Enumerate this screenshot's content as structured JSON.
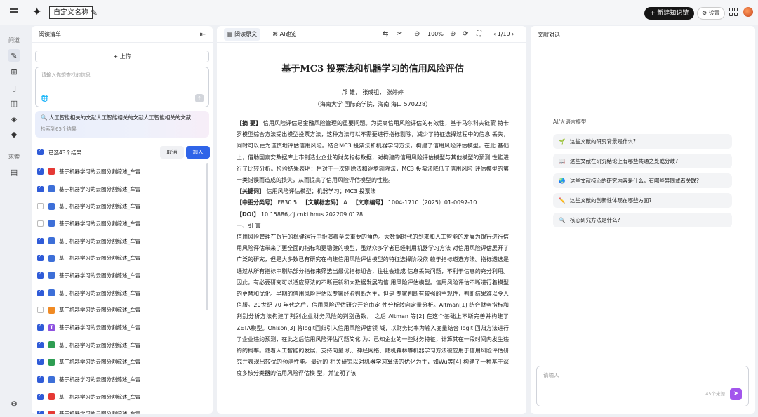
{
  "topbar": {
    "doc_name": "自定义名称",
    "new_kb_label": "+ 新建知识链",
    "settings_label": "⚙ 设置"
  },
  "rail": {
    "section1": "问道",
    "section2": "求索"
  },
  "left": {
    "title": "阅读清单",
    "upload_label": "上传",
    "search_placeholder": "请输入你想查找的信息",
    "query_text": "人工智能相关的文献人工智能相关的文献人工智能相关的文献",
    "query_result": "检索到65个结果",
    "selected_text": "已选43个结果",
    "cancel_label": "取消",
    "join_label": "加入",
    "files": [
      {
        "name": "基于机器学习的云图分割综述_车雷",
        "checked": true,
        "type": "pdf",
        "color": "#e53935",
        "glyph": ""
      },
      {
        "name": "基于机器学习的云图分割综述_车雷",
        "checked": true,
        "type": "web",
        "color": "#3d6fd8",
        "glyph": ""
      },
      {
        "name": "基于机器学习的云图分割综述_车雷",
        "checked": false,
        "type": "web",
        "color": "#3d6fd8",
        "glyph": ""
      },
      {
        "name": "基于机器学习的云图分割综述_车雷",
        "checked": false,
        "type": "web",
        "color": "#3d6fd8",
        "glyph": ""
      },
      {
        "name": "基于机器学习的云图分割综述_车雷",
        "checked": true,
        "type": "web",
        "color": "#3d6fd8",
        "glyph": ""
      },
      {
        "name": "基于机器学习的云图分割综述_车雷",
        "checked": true,
        "type": "web",
        "color": "#3d6fd8",
        "glyph": ""
      },
      {
        "name": "基于机器学习的云图分割综述_车雷",
        "checked": true,
        "type": "web",
        "color": "#3d6fd8",
        "glyph": ""
      },
      {
        "name": "基于机器学习的云图分割综述_车雷",
        "checked": true,
        "type": "web",
        "color": "#3d6fd8",
        "glyph": ""
      },
      {
        "name": "基于机器学习的云图分割综述_车雷",
        "checked": false,
        "type": "ppt",
        "color": "#f08a24",
        "glyph": ""
      },
      {
        "name": "基于机器学习的云图分割综述_车雷",
        "checked": true,
        "type": "text",
        "color": "#8e52e0",
        "glyph": "T"
      },
      {
        "name": "基于机器学习的云图分割综述_车雷",
        "checked": true,
        "type": "sheet",
        "color": "#2e9d52",
        "glyph": ""
      },
      {
        "name": "基于机器学习的云图分割综述_车雷",
        "checked": true,
        "type": "sheet",
        "color": "#2e9d52",
        "glyph": ""
      },
      {
        "name": "基于机器学习的云图分割综述_车雷",
        "checked": true,
        "type": "web",
        "color": "#3d6fd8",
        "glyph": ""
      },
      {
        "name": "基于机器学习的云图分割综述_车雷",
        "checked": true,
        "type": "pdf",
        "color": "#e53935",
        "glyph": ""
      },
      {
        "name": "基于机器学习的云图分割综述_车雷",
        "checked": true,
        "type": "pdf",
        "color": "#e53935",
        "glyph": ""
      }
    ]
  },
  "middle": {
    "tab_read": "阅读原文",
    "tab_ai": "AI速览",
    "zoom": "100%",
    "pager": "1/19",
    "doc_title": "基于MC3 投票法和机器学习的信用风险评估",
    "authors": "邝 雄， 张成祖， 张婷婷",
    "affiliation": "（海南大学 国际商学院，海南 海口 570228）",
    "abstract_label": "【摘 要】",
    "abstract": "信用风险评估是金融风险管理的重要问题。为提高信用风险评估的有效性，基于马尔科夫链蒙 特卡罗模型综合方法提出模型投票方法，这种方法可以不需要进行指标剔除，减少了特征选择过程中的信息 丢失，同时可以更为谨慎地评估信用风险。结合MC3 投票法和机器学习方法，构建了信用风险评估模型。在此 基础上，借助国泰安数据库上市制造业企业的财务指标数据，对构建的信用风险评估模型与其他模型的预测 性能进行了比较分析。检验结果表明：相对于一次剔除法和逐步剔除法，MC3 投票法降低了信用风险 评估模型的第一类错误而造成的损失，从而提高了信用风险评估模型的性能。",
    "keywords_label": "【关键词】",
    "keywords": "信用风险评估模型；机器学习；MC3 投票法",
    "clc_label": "【中图分类号】",
    "clc": "F830.5",
    "doccode_label": "【文献标志码】",
    "doccode": "A",
    "artno_label": "【文章编号】",
    "artno": "1004-1710（2025）01-0097-10",
    "doi_label": "【DOI】",
    "doi": "10.15886／j.cnki.hnus.202209.0128",
    "section1": "一、引 言",
    "intro": "信用风险管理在银行的稳健运行中扮演着至关重要的角色。大数据时代的到来和人工智能的发展为银行进行信用风险评估带来了更全面的指标和更稳健的模型，虽然众多学者已经利用机器学习方法 对信用风险评估展开了广泛的研究，但是大多数已有研究在构建信用风险评估模型的特征选择阶段依 赖于指标遴选方法。指标遴选是通过从所有指标中剔除部分指标来筛选出最优指标组合，往往会造成 信息丢失问题，不利于信息的充分利用。因此，有必要研究可以适应算法的不断更新和大数据发展的信 用风险评估模型。信用风险评估不断进行着模型的更替和优化。早期的信用风险评估以专家经验判断为主，但是 专家判断有较强的主观性，判断结果难以令人信服。20世纪 70 年代之后，信用风险评估研究开始由定 性分析转向定量分析。Altman[1] 结合财务指标和判别分析方法构建了判别企业财务风险的判别函数， 之后 Altman 等[2] 在这个基础上不断完善并构建了ZETA模型。Ohlson[3] 将logit回归引入信用风险评估领 域，以财务比率为输入变量结合 logit 回归方法进行了企业违约预测，在此之后信用风险评估问题简化 为：已知企业的一些财务特征，计算其在一段时间内发生违约的概率。随着人工智能的发展，支持向量 机、神经网络、随机森林等机器学习方法被应用于信用风险评估研究并表现出较优的预测性能。最近的 相关研究以对机器学习算法的优化为主，如Wu等[4] 构建了一种基于深度多核分类器的信用风险评估模 型，并证明了该"
  },
  "right": {
    "title": "文献对话",
    "ai_label": "AI/大语言模型",
    "suggestions": [
      {
        "icon": "🌱",
        "text": "这些文献的研究背景是什么?"
      },
      {
        "icon": "📖",
        "text": "这些文献在研究结论上有哪些共通之处或分歧?"
      },
      {
        "icon": "🌏",
        "text": "这些文献核心的研究内容是什么，有哪些异同或者关联?"
      },
      {
        "icon": "✏️",
        "text": "这些文献的创新性体现在哪些方面?"
      },
      {
        "icon": "🔍",
        "text": "核心研究方法是什么?"
      }
    ],
    "chat_placeholder": "请输入",
    "chat_count": "45个来源"
  }
}
